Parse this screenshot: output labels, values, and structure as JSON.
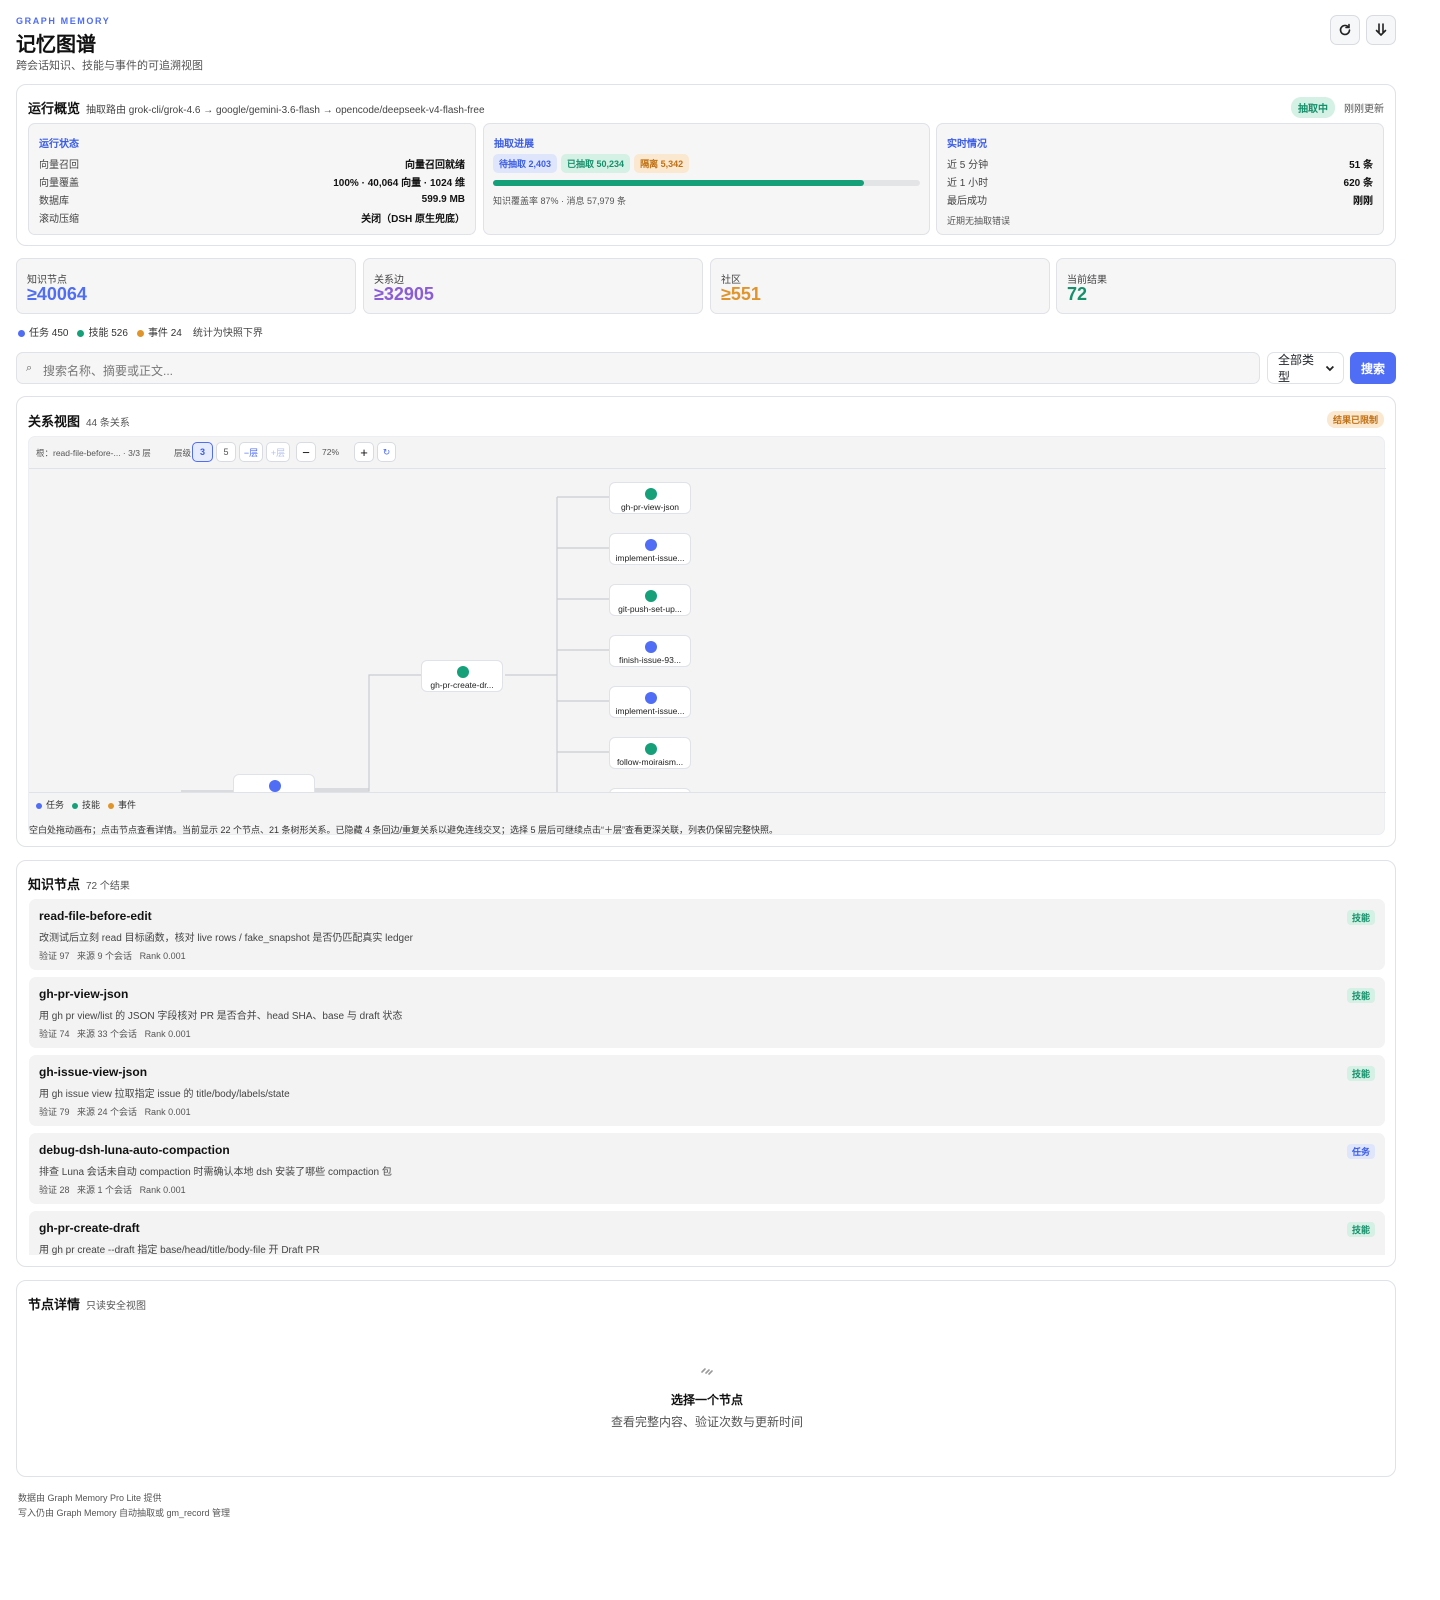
{
  "header": {
    "eyebrow": "GRAPH MEMORY",
    "title": "记忆图谱",
    "subtitle": "跨会话知识、技能与事件的可追溯视图",
    "refresh_icon": "refresh-icon",
    "download_icon": "download-icon"
  },
  "overview": {
    "title": "运行概览",
    "route": "抽取路由 grok-cli/grok-4.6 → google/gemini-3.6-flash → opencode/deepseek-v4-flash-free",
    "status": "抽取中",
    "updated": "刚刚更新",
    "run_state": {
      "title": "运行状态",
      "rows": [
        {
          "k": "向量召回",
          "v": "向量召回就绪"
        },
        {
          "k": "向量覆盖",
          "v": "100% · 40,064 向量 · 1024 维"
        },
        {
          "k": "数据库",
          "v": "599.9 MB"
        },
        {
          "k": "滚动压缩",
          "v": "关闭（DSH 原生兜底）"
        }
      ]
    },
    "progress": {
      "title": "抽取进展",
      "pending": "待抽取 2,403",
      "done": "已抽取 50,234",
      "isolated": "隔离 5,342",
      "fraction": 0.87,
      "note": "知识覆盖率 87% · 消息 57,979 条"
    },
    "realtime": {
      "title": "实时情况",
      "rows": [
        {
          "k": "近 5 分钟",
          "v": "51 条"
        },
        {
          "k": "近 1 小时",
          "v": "620 条"
        },
        {
          "k": "最后成功",
          "v": "刚刚"
        }
      ],
      "note": "近期无抽取错误"
    }
  },
  "stats": {
    "nodes": {
      "label": "知识节点",
      "value": "≥40064",
      "color": "#4f6df5"
    },
    "edges": {
      "label": "关系边",
      "value": "≥32905",
      "color": "#8a5cd6"
    },
    "communities": {
      "label": "社区",
      "value": "≥551",
      "color": "#e0952a"
    },
    "results": {
      "label": "当前结果",
      "value": "72",
      "color": "#15906a"
    }
  },
  "legend_counts": {
    "task": "任务 450",
    "skill": "技能 526",
    "event": "事件 24",
    "note": "统计为快照下界"
  },
  "colors": {
    "task": "#4f6df5",
    "skill": "#15a07a",
    "event": "#e0952a"
  },
  "search": {
    "placeholder": "搜索名称、摘要或正文...",
    "type_select": "全部类型",
    "button": "搜索"
  },
  "graph": {
    "title": "关系视图",
    "count": "44 条关系",
    "limited": "结果已限制",
    "toolbar": {
      "root": "根：read-file-before-... · 3/3 层",
      "depth_label": "层级",
      "depth_3": "3",
      "depth_5": "5",
      "minus_layer": "−层",
      "plus_layer": "+层",
      "zoom_out": "−",
      "zoom": "72%",
      "zoom_in": "+",
      "reset": "↻"
    },
    "mid_node": "gh-pr-create-dr...",
    "leaves": [
      {
        "label": "gh-pr-view-json",
        "kind": "skill"
      },
      {
        "label": "implement-issue...",
        "kind": "task"
      },
      {
        "label": "git-push-set-up...",
        "kind": "skill"
      },
      {
        "label": "finish-issue-93...",
        "kind": "task"
      },
      {
        "label": "implement-issue...",
        "kind": "task"
      },
      {
        "label": "follow-moiraism...",
        "kind": "skill"
      }
    ],
    "legend": {
      "task": "任务",
      "skill": "技能",
      "event": "事件"
    },
    "hint": "空白处拖动画布；点击节点查看详情。当前显示 22 个节点、21 条树形关系。已隐藏 4 条回边/重复关系以避免连线交叉；选择 5 层后可继续点击“＋层”查看更深关联，列表仍保留完整快照。"
  },
  "results": {
    "title": "知识节点",
    "count": "72 个结果",
    "items": [
      {
        "title": "read-file-before-edit",
        "summary": "改测试后立刻 read 目标函数，核对 live rows / fake_snapshot 是否仍匹配真实 ledger",
        "verify": "验证 97",
        "source": "来源 9 个会话",
        "rank": "Rank 0.001",
        "tag": "技能",
        "kind": "skill"
      },
      {
        "title": "gh-pr-view-json",
        "summary": "用 gh pr view/list 的 JSON 字段核对 PR 是否合并、head SHA、base 与 draft 状态",
        "verify": "验证 74",
        "source": "来源 33 个会话",
        "rank": "Rank 0.001",
        "tag": "技能",
        "kind": "skill"
      },
      {
        "title": "gh-issue-view-json",
        "summary": "用 gh issue view 拉取指定 issue 的 title/body/labels/state",
        "verify": "验证 79",
        "source": "来源 24 个会话",
        "rank": "Rank 0.001",
        "tag": "技能",
        "kind": "skill"
      },
      {
        "title": "debug-dsh-luna-auto-compaction",
        "summary": "排查 Luna 会话未自动 compaction 时需确认本地 dsh 安装了哪些 compaction 包",
        "verify": "验证 28",
        "source": "来源 1 个会话",
        "rank": "Rank 0.001",
        "tag": "任务",
        "kind": "task"
      },
      {
        "title": "gh-pr-create-draft",
        "summary": "用 gh pr create --draft 指定 base/head/title/body-file 开 Draft PR",
        "verify": "",
        "source": "",
        "rank": "",
        "tag": "技能",
        "kind": "skill"
      }
    ]
  },
  "detail": {
    "title": "节点详情",
    "subtitle": "只读安全视图",
    "empty_icon": "link-icon",
    "empty_title": "选择一个节点",
    "empty_desc": "查看完整内容、验证次数与更新时间"
  },
  "footer": {
    "line1": "数据由 Graph Memory Pro Lite 提供",
    "line2": "写入仍由 Graph Memory 自动抽取或 gm_record 管理"
  }
}
